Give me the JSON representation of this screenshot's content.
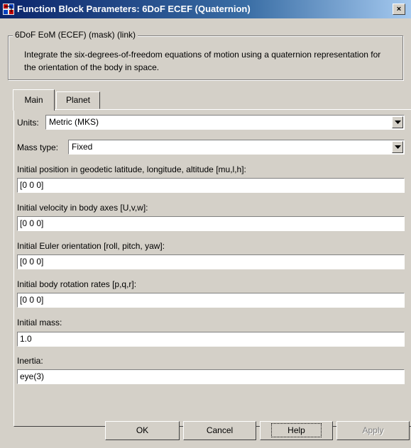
{
  "window": {
    "title": "Function Block Parameters: 6DoF ECEF (Quaternion)",
    "close_glyph": "×",
    "icon": "simulink-block-icon",
    "titlebar_color": "#0a246a"
  },
  "group": {
    "legend": "6DoF EoM (ECEF) (mask) (link)",
    "description": "Integrate the six-degrees-of-freedom equations of motion using a quaternion representation for the orientation of the body in space."
  },
  "tabs": [
    {
      "label": "Main",
      "selected": true
    },
    {
      "label": "Planet",
      "selected": false
    }
  ],
  "params": {
    "units": {
      "label": "Units:",
      "value": "Metric (MKS)"
    },
    "mass_type": {
      "label": "Mass type:",
      "value": "Fixed"
    },
    "fields": [
      {
        "label": "Initial position in geodetic latitude, longitude, altitude [mu,l,h]:",
        "value": "[0 0 0]"
      },
      {
        "label": "Initial velocity in body axes [U,v,w]:",
        "value": "[0 0 0]"
      },
      {
        "label": "Initial Euler orientation [roll, pitch, yaw]:",
        "value": "[0 0 0]"
      },
      {
        "label": "Initial body rotation rates [p,q,r]:",
        "value": "[0 0 0]"
      },
      {
        "label": "Initial mass:",
        "value": "1.0"
      },
      {
        "label": "Inertia:",
        "value": "eye(3)"
      }
    ]
  },
  "buttons": {
    "ok": "OK",
    "cancel": "Cancel",
    "help": "Help",
    "apply": "Apply"
  }
}
